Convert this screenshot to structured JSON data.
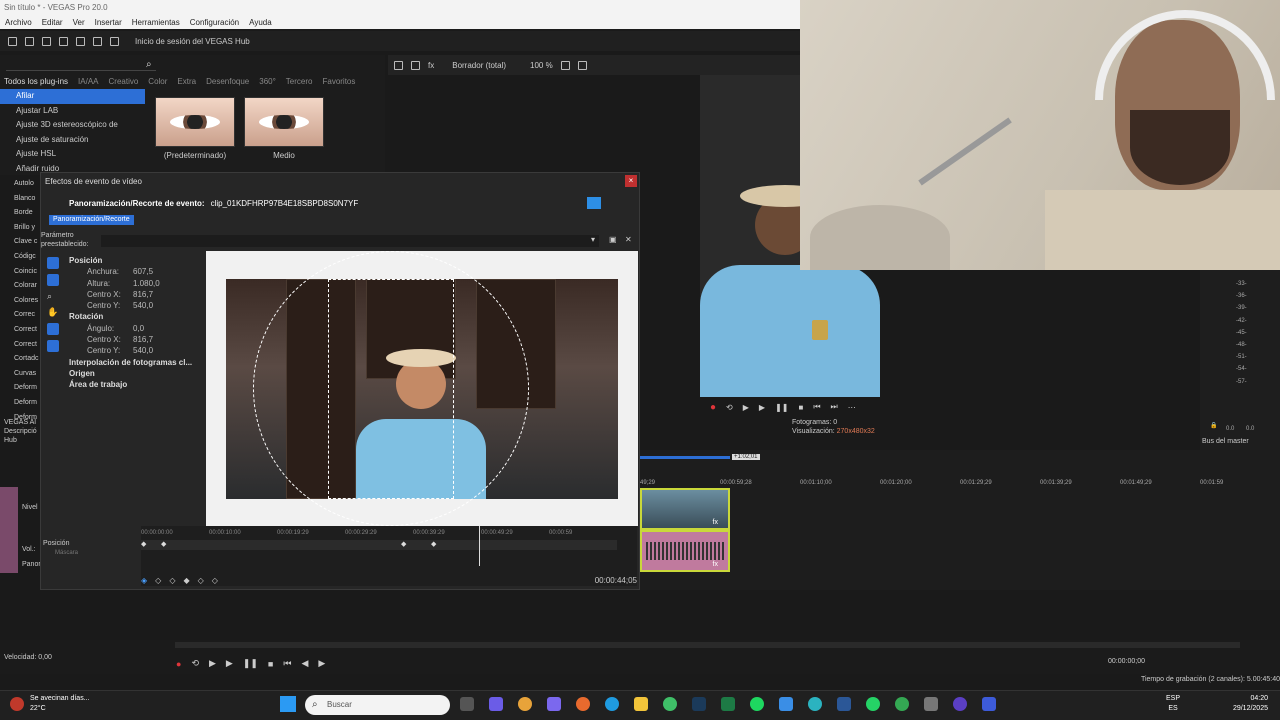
{
  "app": {
    "title": "Sin título * - VEGAS Pro 20.0"
  },
  "menu": [
    "Archivo",
    "Editar",
    "Ver",
    "Insertar",
    "Herramientas",
    "Configuración",
    "Ayuda"
  ],
  "toolbar": {
    "hub_label": "Inicio de sesión del VEGAS Hub"
  },
  "fx_browser": {
    "tabs": [
      "Todos los plug-ins",
      "IA/AA",
      "Creativo",
      "Color",
      "Extra",
      "Desenfoque",
      "360°",
      "Tercero",
      "Favoritos"
    ],
    "items": [
      "Afilar",
      "Ajustar LAB",
      "Ajuste 3D estereoscópico de",
      "Ajuste de saturación",
      "Ajuste HSL",
      "Añadir ruido"
    ],
    "presets": [
      "(Predeterminado)",
      "Medio"
    ]
  },
  "preview_toolbar": {
    "mode": "Borrador (total)",
    "zoom": "100 %"
  },
  "preview_info": {
    "frame_label": "Fotogramas:",
    "frame_value": "0",
    "display_label": "Visualización:",
    "display_value": "270x480x32"
  },
  "mixer": {
    "scale": [
      "-33-",
      "-36-",
      "-39-",
      "-42-",
      "-45-",
      "-48-",
      "-51-",
      "-54-",
      "-57-"
    ],
    "left": "0.0",
    "right": "0.0",
    "label": "Bus del master"
  },
  "dialog": {
    "title": "Efectos de evento de vídeo",
    "plugin": "Panoramización/Recorte de evento:",
    "clip": "clip_01KDFHRP97B4E18SBPD8S0N7YF",
    "pill": "Panoramización/Recorte",
    "preset_label": "Parámetro preestablecido:",
    "props": [
      {
        "type": "h",
        "label": "Posición"
      },
      {
        "type": "r",
        "k": "Anchura:",
        "v": "607,5"
      },
      {
        "type": "r",
        "k": "Altura:",
        "v": "1.080,0"
      },
      {
        "type": "r",
        "k": "Centro X:",
        "v": "816,7"
      },
      {
        "type": "r",
        "k": "Centro Y:",
        "v": "540,0"
      },
      {
        "type": "h",
        "label": "Rotación"
      },
      {
        "type": "r",
        "k": "Ángulo:",
        "v": "0,0"
      },
      {
        "type": "r",
        "k": "Centro X:",
        "v": "816,7"
      },
      {
        "type": "r",
        "k": "Centro Y:",
        "v": "540,0"
      },
      {
        "type": "h",
        "label": "Interpolación de fotogramas cl..."
      },
      {
        "type": "h",
        "label": "Origen"
      },
      {
        "type": "h",
        "label": "Área de trabajo"
      }
    ],
    "kf_ruler": [
      "00:00:00:00",
      "00:00:10:00",
      "00:00:19:29",
      "00:00:29:29",
      "00:00:39:29",
      "00:00:49:29",
      "00:00:59"
    ],
    "kf_track": "Posición",
    "kf_mask": "Máscara",
    "kf_time": "00:00:44;05"
  },
  "left_panel": {
    "items": [
      "Autolo",
      "Blanco",
      "Borde",
      "Brillo y",
      "Clave c",
      "Códigc",
      "Coincic",
      "Colorar",
      "Colores",
      "Correc",
      "Correct",
      "Correct",
      "Cortadc",
      "Curvas",
      "Deform",
      "Deform",
      "Deform"
    ],
    "hub_a": "VEGAS Al",
    "hub_b": "Descripció",
    "hub_c": "Hub",
    "track1": "Nivel",
    "track2": "Vol.:",
    "track2b": "Panor"
  },
  "timeline": {
    "ruler": [
      "49;29",
      "00:00:59;28",
      "00:01:10;00",
      "00:01:20;00",
      "00:01:29;29",
      "00:01:39;29",
      "00:01:49;29",
      "00:01:59"
    ],
    "marker": "+1:02;01",
    "speed": "Velocidad: 0,00",
    "cursor_time": "00:00:00;00",
    "rec_time": "Tiempo de grabación (2 canales): 5.00:45:40"
  },
  "taskbar": {
    "weather_title": "Se avecinan días...",
    "weather_temp": "22°C",
    "search": "Buscar",
    "lang1": "ESP",
    "lang2": "ES",
    "time": "04:20",
    "date": "29/12/2025"
  }
}
